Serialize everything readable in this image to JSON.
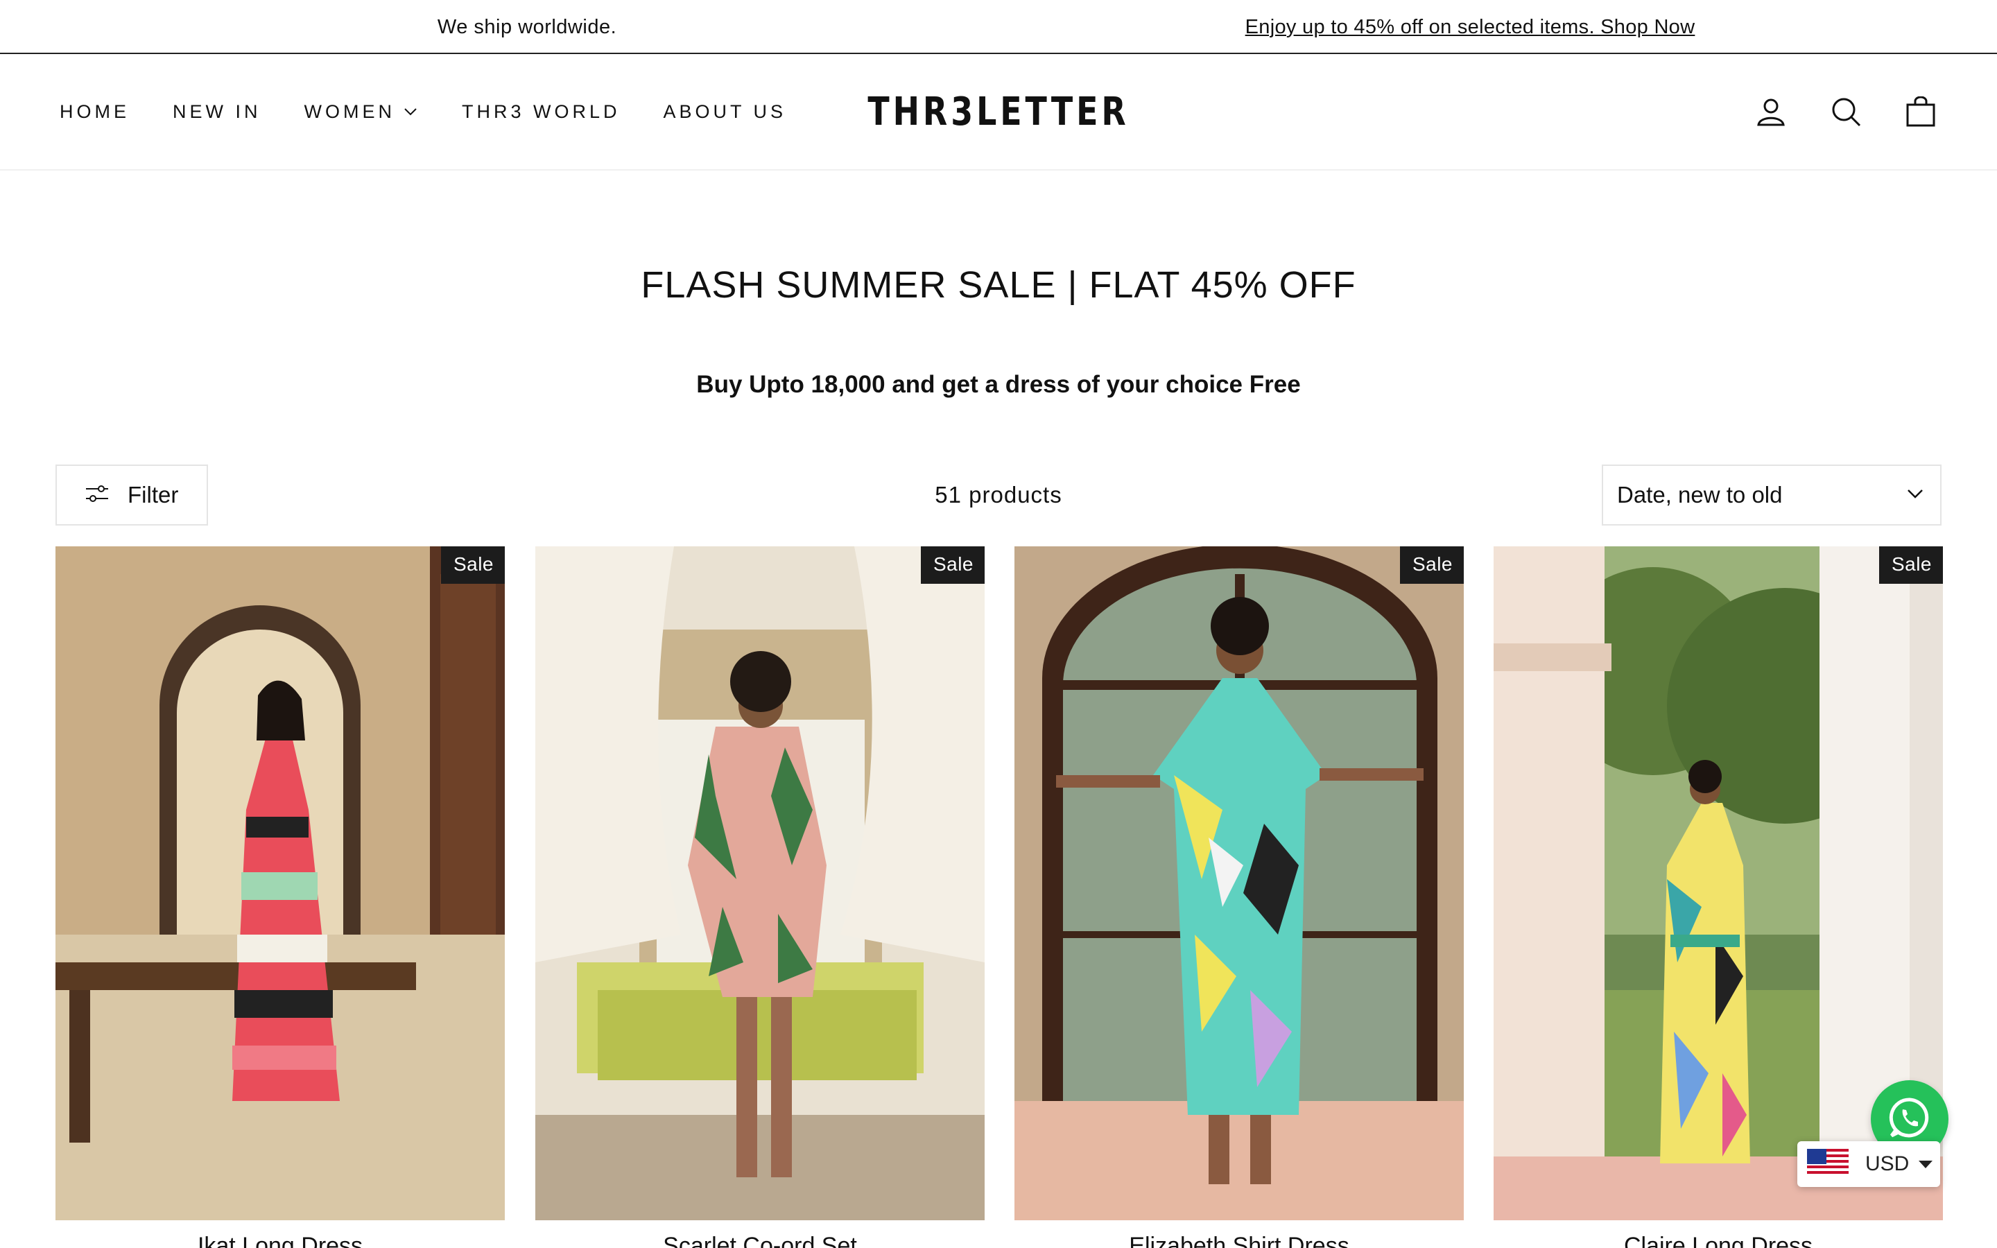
{
  "announcement": {
    "left_text": "We ship worldwide.",
    "right_link": "Enjoy up to 45% off on selected items. Shop Now"
  },
  "header": {
    "nav": [
      {
        "label": "HOME"
      },
      {
        "label": "NEW IN"
      },
      {
        "label": "WOMEN",
        "has_dropdown": true
      },
      {
        "label": "THR3 WORLD"
      },
      {
        "label": "ABOUT US"
      }
    ],
    "logo": "THR3LETTER",
    "icons": [
      "account-icon",
      "search-icon",
      "cart-icon"
    ]
  },
  "collection": {
    "title": "FLASH SUMMER SALE | FLAT 45% OFF",
    "subtitle": "Buy Upto 18,000 and get a dress of your choice Free"
  },
  "toolbar": {
    "filter_label": "Filter",
    "product_count": "51 products",
    "sort_value": "Date, new to old"
  },
  "products": [
    {
      "name": "Ikat Long Dress",
      "badge": "Sale"
    },
    {
      "name": "Scarlet Co-ord Set",
      "badge": "Sale"
    },
    {
      "name": "Elizabeth Shirt Dress",
      "badge": "Sale"
    },
    {
      "name": "Claire Long Dress",
      "badge": "Sale"
    }
  ],
  "widgets": {
    "whatsapp_icon": "whatsapp-icon",
    "currency_code": "USD",
    "currency_flag": "us-flag-icon"
  },
  "colors": {
    "badge_bg": "#1c1c1c",
    "whatsapp_green": "#25c15a",
    "border": "#e4e4e4"
  }
}
